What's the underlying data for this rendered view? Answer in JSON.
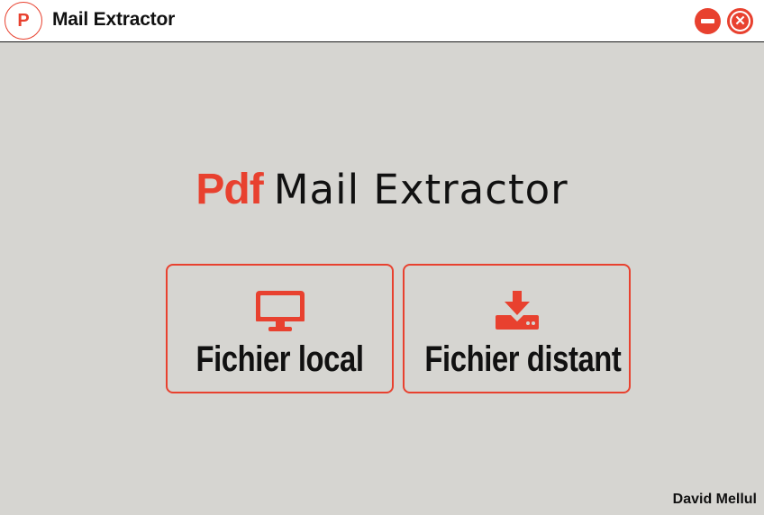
{
  "window": {
    "logo_letter": "P",
    "title": "Mail Extractor"
  },
  "heading": {
    "brand": "Pdf",
    "title": "Mail Extractor"
  },
  "cards": [
    {
      "label": "Fichier local",
      "icon": "monitor-icon"
    },
    {
      "label": "Fichier distant",
      "icon": "download-server-icon"
    }
  ],
  "footer": {
    "author": "David Mellul"
  },
  "colors": {
    "accent": "#e8412f",
    "background": "#d6d5d1",
    "titlebar": "#ffffff",
    "text": "#111111"
  }
}
